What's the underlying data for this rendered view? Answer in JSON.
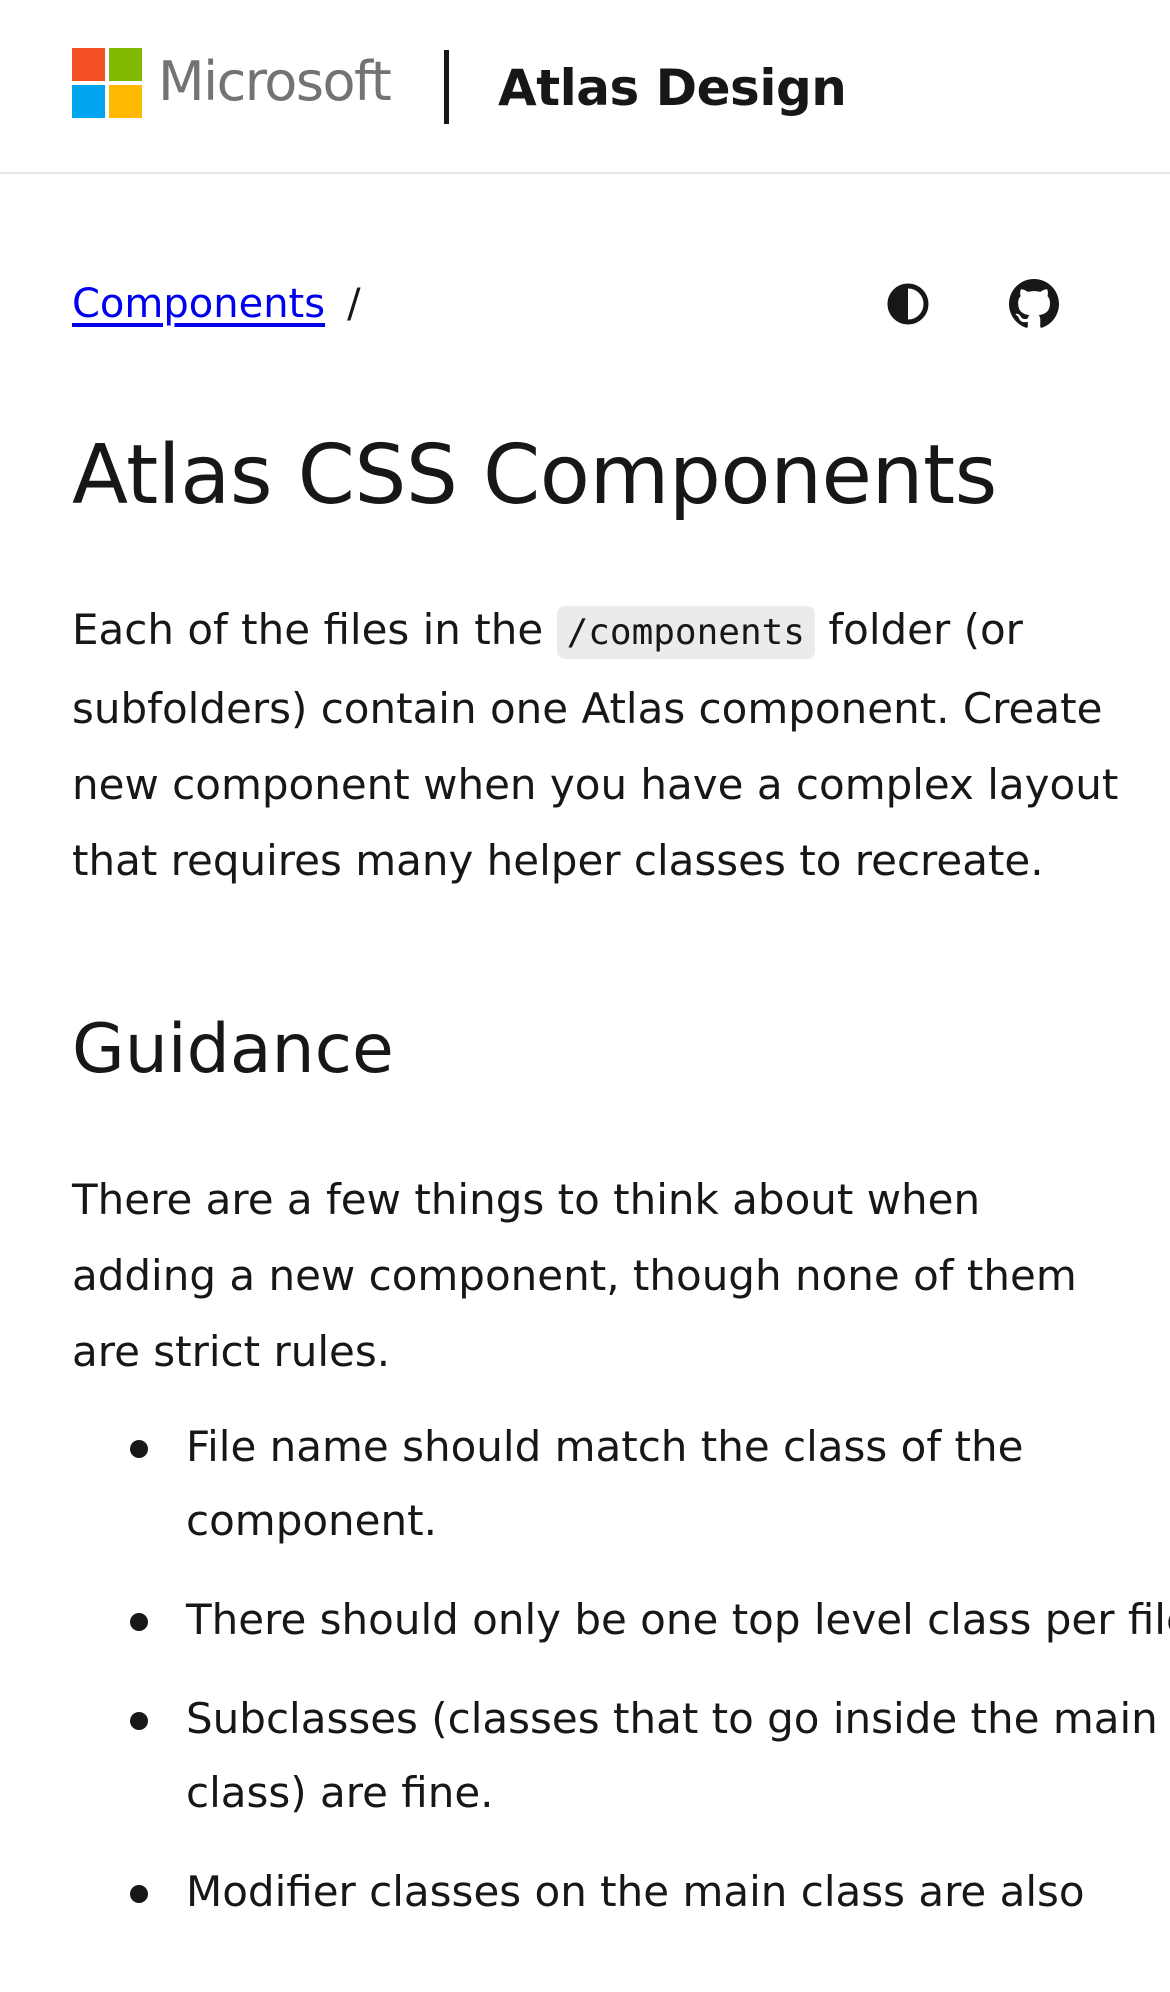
{
  "header": {
    "brand": "Microsoft",
    "site_title": "Atlas Design"
  },
  "breadcrumb": {
    "link": "Components",
    "separator": "/"
  },
  "toolbar": {
    "theme_icon": "theme-toggle-icon",
    "github_icon": "github-icon"
  },
  "main": {
    "title": "Atlas CSS Components",
    "intro_before": "Each of the files in the ",
    "intro_code": "/components",
    "intro_after": " folder (or subfolders) contain one Atlas component. Create new component when you have a complex layout that requires many helper classes to recreate.",
    "guidance_heading": "Guidance",
    "guidance_text": "There are a few things to think about when adding a new component, though none of them are strict rules.",
    "rules": [
      "File name should match the class of the component.",
      "There should only be one top level class per file.",
      "Subclasses (classes that to go inside the main class) are fine.",
      "Modifier classes on the main class are also"
    ]
  },
  "colors": {
    "ms_red": "#f25022",
    "ms_green": "#7fba00",
    "ms_blue": "#00a4ef",
    "ms_yellow": "#ffb900",
    "link": "#0000ee",
    "text": "#171717"
  }
}
